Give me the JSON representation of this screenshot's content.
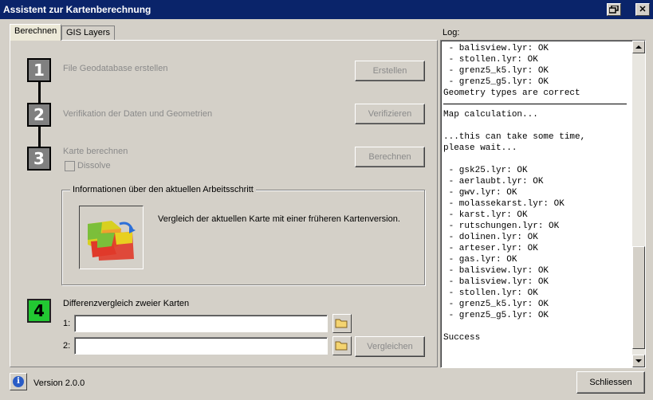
{
  "window": {
    "title": "Assistent zur Kartenberechnung",
    "restore_icon": "restore-icon",
    "close_glyph": "✕"
  },
  "tabs": [
    {
      "label": "Berechnen",
      "active": true
    },
    {
      "label": "GIS Layers",
      "active": false
    }
  ],
  "steps": [
    {
      "number": "1",
      "label": "File Geodatabase erstellen",
      "button": "Erstellen"
    },
    {
      "number": "2",
      "label": "Verifikation der Daten und Geometrien",
      "button": "Verifizieren"
    },
    {
      "number": "3",
      "label": "Karte berechnen",
      "button": "Berechnen",
      "checkbox_label": "Dissolve"
    },
    {
      "number": "4",
      "label": "Differenzvergleich zweier Karten"
    }
  ],
  "info_group": {
    "title": "Informationen über den aktuellen Arbeitsschritt",
    "text": "Vergleich der aktuellen Karte mit einer früheren Kartenversion."
  },
  "compare": {
    "field1_label": "1:",
    "field1_value": "",
    "field2_label": "2:",
    "field2_value": "",
    "button": "Vergleichen"
  },
  "log": {
    "label": "Log:",
    "lines_before": [
      " - balisview.lyr: OK",
      " - stollen.lyr: OK",
      " - grenz5_k5.lyr: OK",
      " - grenz5_g5.lyr: OK",
      "Geometry types are correct"
    ],
    "lines_after": [
      "Map calculation...",
      "",
      "...this can take some time,",
      "please wait...",
      "",
      " - gsk25.lyr: OK",
      " - aerlaubt.lyr: OK",
      " - gwv.lyr: OK",
      " - molassekarst.lyr: OK",
      " - karst.lyr: OK",
      " - rutschungen.lyr: OK",
      " - dolinen.lyr: OK",
      " - arteser.lyr: OK",
      " - gas.lyr: OK",
      " - balisview.lyr: OK",
      " - balisview.lyr: OK",
      " - stollen.lyr: OK",
      " - grenz5_k5.lyr: OK",
      " - grenz5_g5.lyr: OK",
      "",
      "Success"
    ]
  },
  "footer": {
    "version": "Version 2.0.0",
    "close_button": "Schliessen"
  },
  "colors": {
    "titlebar": "#0a246a",
    "step_inactive": "#808080",
    "step_active": "#22c832",
    "disabled_text": "#8a8a8a"
  }
}
